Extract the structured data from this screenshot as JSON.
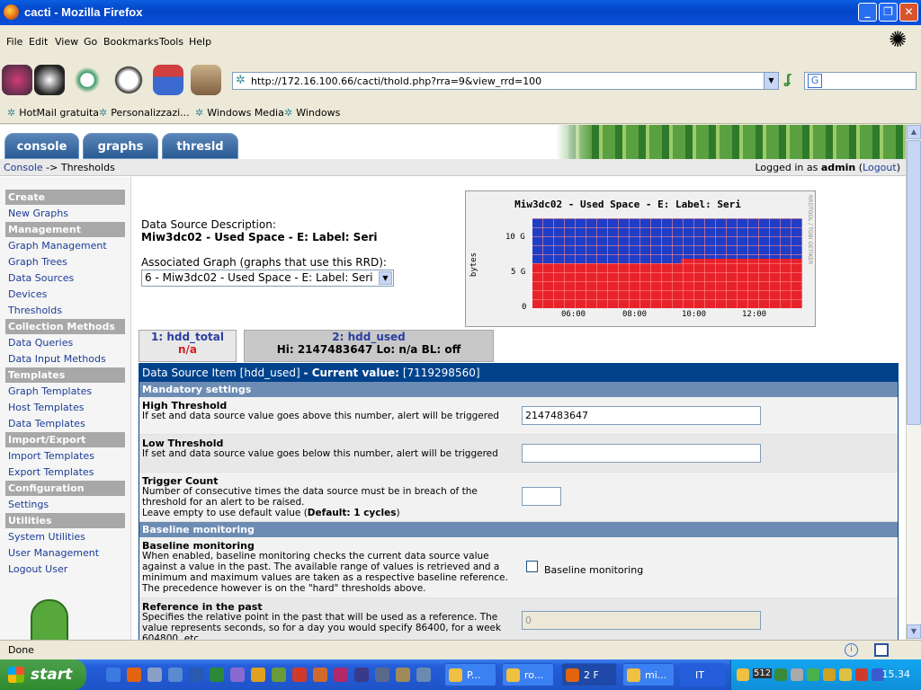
{
  "window": {
    "title": "cacti - Mozilla Firefox"
  },
  "menu": [
    "File",
    "Edit",
    "View",
    "Go",
    "Bookmarks",
    "Tools",
    "Help"
  ],
  "address": {
    "url": "http://172.16.100.66/cacti/thold.php?rra=9&view_rrd=100"
  },
  "bookmarks": [
    "HotMail gratuita",
    "Personalizzazi...",
    "Windows Media",
    "Windows"
  ],
  "tabs": [
    "console",
    "graphs",
    "thresld"
  ],
  "breadcrumb": {
    "console": "Console",
    "sep": "->",
    "current": "Thresholds"
  },
  "login": {
    "prefix": "Logged in as",
    "user": "admin",
    "logout": "Logout"
  },
  "sidebar": [
    {
      "header": "Create",
      "items": [
        "New Graphs"
      ]
    },
    {
      "header": "Management",
      "items": [
        "Graph Management",
        "Graph Trees",
        "Data Sources",
        "Devices",
        "Thresholds"
      ]
    },
    {
      "header": "Collection Methods",
      "items": [
        "Data Queries",
        "Data Input Methods"
      ]
    },
    {
      "header": "Templates",
      "items": [
        "Graph Templates",
        "Host Templates",
        "Data Templates"
      ]
    },
    {
      "header": "Import/Export",
      "items": [
        "Import Templates",
        "Export Templates"
      ]
    },
    {
      "header": "Configuration",
      "items": [
        "Settings"
      ]
    },
    {
      "header": "Utilities",
      "items": [
        "System Utilities",
        "User Management",
        "Logout User"
      ]
    }
  ],
  "main": {
    "ds_desc_label": "Data Source Description:",
    "ds_desc_value": "Miw3dc02 - Used Space - E: Label: Seri",
    "assoc_label": "Associated Graph (graphs that use this RRD):",
    "assoc_value": "6 - Miw3dc02 - Used Space - E: Label: Seri"
  },
  "graph": {
    "title": "Miw3dc02 - Used Space - E: Label:  Seri",
    "ylabel": "bytes",
    "side_text": "RRDTOOL / TOBI OETIKER",
    "yticks": [
      "10 G",
      "5 G",
      "0"
    ],
    "xticks": [
      "06:00",
      "08:00",
      "10:00",
      "12:00"
    ]
  },
  "ds_tabs": [
    {
      "name": "1: hdd_total",
      "value": "n/a"
    },
    {
      "name": "2: hdd_used",
      "value": "Hi: 2147483647 Lo: n/a BL: off"
    }
  ],
  "panel": {
    "head_prefix": "Data Source Item",
    "head_item": "[hdd_used]",
    "head_cv_label": "- Current value:",
    "head_cv": "[7119298560]",
    "mandatory": "Mandatory settings",
    "high_title": "High Threshold",
    "high_desc": "If set and data source value goes above this number, alert will be triggered",
    "high_value": "2147483647",
    "low_title": "Low Threshold",
    "low_desc": "If set and data source value goes below this number, alert will be triggered",
    "low_value": "",
    "trigger_title": "Trigger Count",
    "trigger_desc": "Number of consecutive times the data source must be in breach of the threshold for an alert to be raised.",
    "trigger_desc2": "Leave empty to use default value (",
    "trigger_default": "Default: 1 cycles",
    "trigger_desc3": ")",
    "trigger_value": "",
    "baseline_section": "Baseline monitoring",
    "baseline_title": "Baseline monitoring",
    "baseline_desc": "When enabled, baseline monitoring checks the current data source value against a value in the past. The available range of values is retrieved and a minimum and maximum values are taken as a respective baseline reference. The precedence however is on the \"hard\" thresholds above.",
    "baseline_checkbox_label": "Baseline monitoring",
    "ref_title": "Reference in the past",
    "ref_desc": "Specifies the relative point in the past that will be used as a reference. The value represents seconds, so for a day you would specify 86400, for a week 604800, etc.",
    "ref_value": "0"
  },
  "status": {
    "text": "Done"
  },
  "taskbar": {
    "start": "start",
    "buttons": [
      "P...",
      "ro...",
      "2 F",
      "mi...",
      "IT"
    ],
    "tray_num": "512",
    "clock": "15.34"
  }
}
